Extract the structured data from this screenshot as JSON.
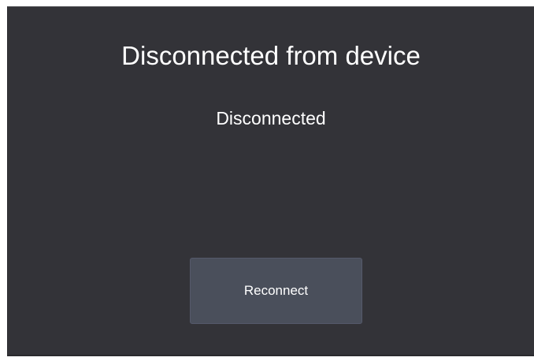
{
  "dialog": {
    "title": "Disconnected from device",
    "status": "Disconnected",
    "reconnect_label": "Reconnect"
  },
  "colors": {
    "dialog_background": "#333338",
    "button_background": "#4a4f5b",
    "text": "#ffffff"
  }
}
